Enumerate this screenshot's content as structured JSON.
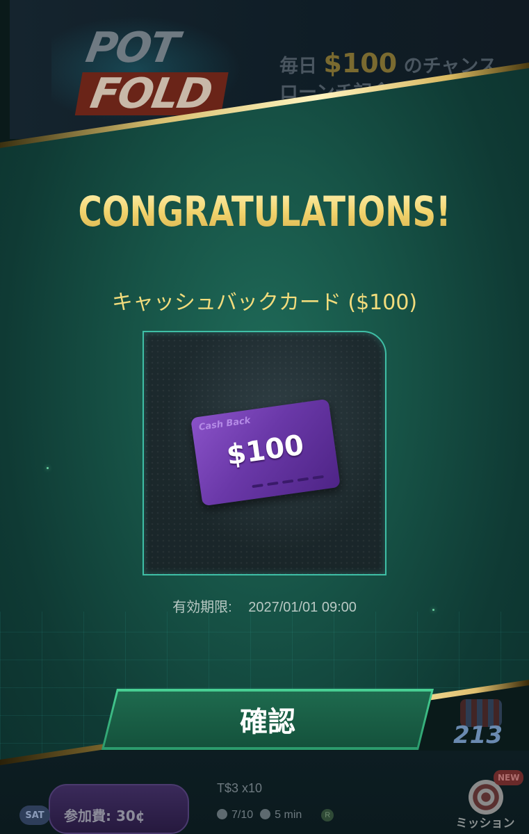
{
  "background": {
    "banner": {
      "logo_line1": "POT",
      "logo_line2": "FOLD",
      "promo_prefix": "毎日 ",
      "promo_amount": "$100",
      "promo_suffix": " のチャンス",
      "promo_line2": "ローンチ記念ミ"
    },
    "tournament": {
      "badge": "SAT",
      "entry_fee": "参加費: 30¢",
      "title": "T$3 x10",
      "players": "7/10",
      "duration": "5 min",
      "mode_badge": "R"
    },
    "side_icons": {
      "chips_number": "213",
      "mission_label": "ミッション",
      "mission_badge": "NEW"
    }
  },
  "modal": {
    "title": "CONGRATULATIONS!",
    "reward_name": "キャッシュバックカード ($100)",
    "card": {
      "label": "Cash Back",
      "amount": "$100",
      "color": "#6a38a8"
    },
    "expiry_label": "有効期限:",
    "expiry_value": "2027/01/01 09:00",
    "confirm_label": "確認",
    "accent_color": "#3fbfa6",
    "title_color": "#f2d46e"
  }
}
